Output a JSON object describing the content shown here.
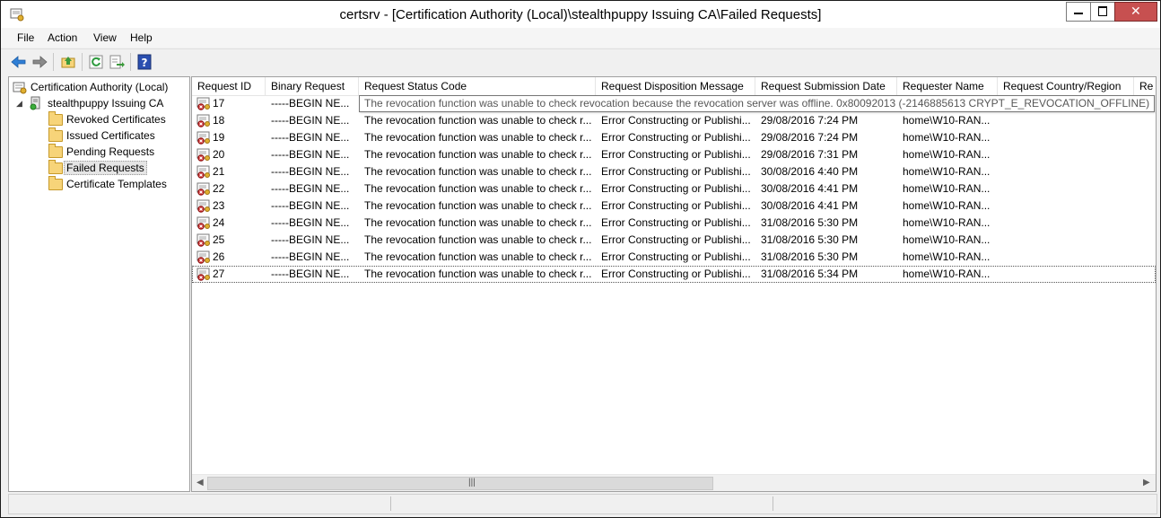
{
  "window": {
    "title": "certsrv - [Certification Authority (Local)\\stealthpuppy Issuing CA\\Failed Requests]"
  },
  "menu": [
    "File",
    "Action",
    "View",
    "Help"
  ],
  "toolbar": {
    "icons": [
      "back-arrow-icon",
      "forward-arrow-icon",
      "up-folder-icon",
      "refresh-icon",
      "export-list-icon",
      "help-icon"
    ]
  },
  "tree": {
    "root": "Certification Authority (Local)",
    "ca": "stealthpuppy Issuing CA",
    "children": [
      "Revoked Certificates",
      "Issued Certificates",
      "Pending Requests",
      "Failed Requests",
      "Certificate Templates"
    ],
    "selected": "Failed Requests"
  },
  "list": {
    "columns": [
      "Request ID",
      "Binary Request",
      "Request Status Code",
      "Request Disposition Message",
      "Request Submission Date",
      "Requester Name",
      "Request Country/Region",
      "Re"
    ],
    "rows": [
      {
        "id": "17",
        "binary": "-----BEGIN NE...",
        "status": "",
        "disposition": "",
        "date": "",
        "requester": ""
      },
      {
        "id": "18",
        "binary": "-----BEGIN NE...",
        "status": "The revocation function was unable to check r...",
        "disposition": "Error Constructing or Publishi...",
        "date": "29/08/2016 7:24 PM",
        "requester": "home\\W10-RAN..."
      },
      {
        "id": "19",
        "binary": "-----BEGIN NE...",
        "status": "The revocation function was unable to check r...",
        "disposition": "Error Constructing or Publishi...",
        "date": "29/08/2016 7:24 PM",
        "requester": "home\\W10-RAN..."
      },
      {
        "id": "20",
        "binary": "-----BEGIN NE...",
        "status": "The revocation function was unable to check r...",
        "disposition": "Error Constructing or Publishi...",
        "date": "29/08/2016 7:31 PM",
        "requester": "home\\W10-RAN..."
      },
      {
        "id": "21",
        "binary": "-----BEGIN NE...",
        "status": "The revocation function was unable to check r...",
        "disposition": "Error Constructing or Publishi...",
        "date": "30/08/2016 4:40 PM",
        "requester": "home\\W10-RAN..."
      },
      {
        "id": "22",
        "binary": "-----BEGIN NE...",
        "status": "The revocation function was unable to check r...",
        "disposition": "Error Constructing or Publishi...",
        "date": "30/08/2016 4:41 PM",
        "requester": "home\\W10-RAN..."
      },
      {
        "id": "23",
        "binary": "-----BEGIN NE...",
        "status": "The revocation function was unable to check r...",
        "disposition": "Error Constructing or Publishi...",
        "date": "30/08/2016 4:41 PM",
        "requester": "home\\W10-RAN..."
      },
      {
        "id": "24",
        "binary": "-----BEGIN NE...",
        "status": "The revocation function was unable to check r...",
        "disposition": "Error Constructing or Publishi...",
        "date": "31/08/2016 5:30 PM",
        "requester": "home\\W10-RAN..."
      },
      {
        "id": "25",
        "binary": "-----BEGIN NE...",
        "status": "The revocation function was unable to check r...",
        "disposition": "Error Constructing or Publishi...",
        "date": "31/08/2016 5:30 PM",
        "requester": "home\\W10-RAN..."
      },
      {
        "id": "26",
        "binary": "-----BEGIN NE...",
        "status": "The revocation function was unable to check r...",
        "disposition": "Error Constructing or Publishi...",
        "date": "31/08/2016 5:30 PM",
        "requester": "home\\W10-RAN..."
      },
      {
        "id": "27",
        "binary": "-----BEGIN NE...",
        "status": "The revocation function was unable to check r...",
        "disposition": "Error Constructing or Publishi...",
        "date": "31/08/2016 5:34 PM",
        "requester": "home\\W10-RAN..."
      }
    ],
    "tooltip": "The revocation function was unable to check revocation because the revocation server was offline. 0x80092013 (-2146885613 CRYPT_E_REVOCATION_OFFLINE)"
  },
  "colors": {
    "window_bg": "#f0f0f0",
    "close_button": "#c75050",
    "folder": "#f7d479"
  }
}
